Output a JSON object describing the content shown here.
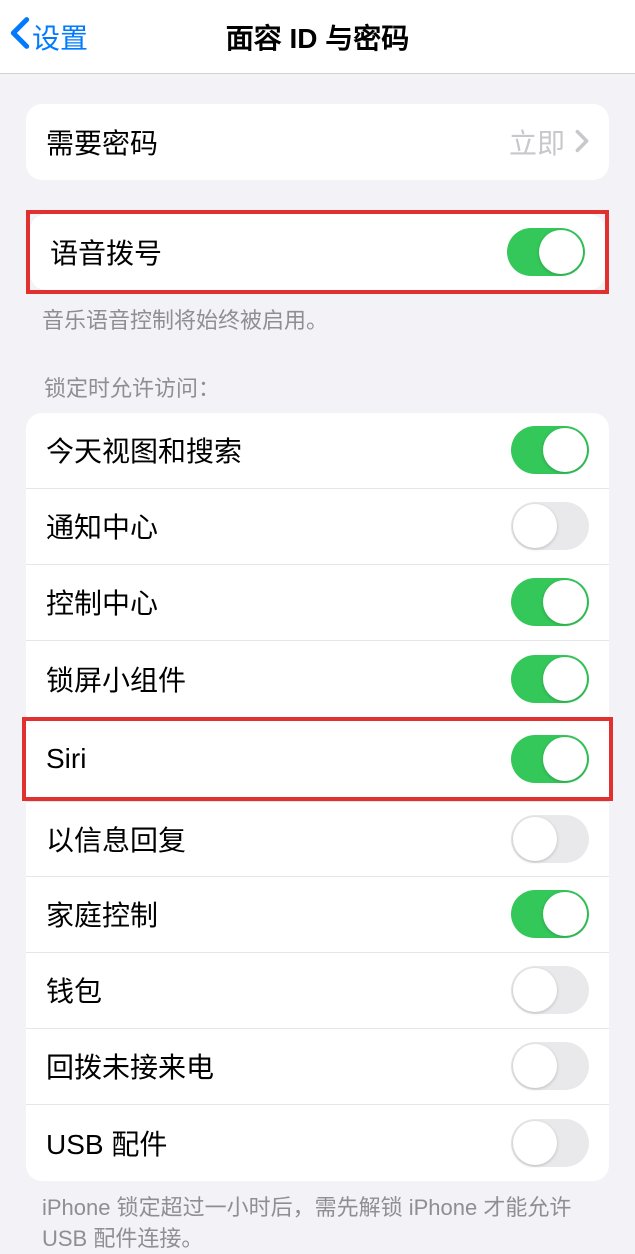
{
  "header": {
    "back_label": "设置",
    "title": "面容 ID 与密码"
  },
  "passcode_row": {
    "label": "需要密码",
    "value": "立即"
  },
  "voice_dial": {
    "label": "语音拨号",
    "on": true,
    "footer": "音乐语音控制将始终被启用。"
  },
  "lock_section": {
    "header": "锁定时允许访问：",
    "items": [
      {
        "label": "今天视图和搜索",
        "on": true
      },
      {
        "label": "通知中心",
        "on": false
      },
      {
        "label": "控制中心",
        "on": true
      },
      {
        "label": "锁屏小组件",
        "on": true
      },
      {
        "label": "Siri",
        "on": true,
        "highlight": true
      },
      {
        "label": "以信息回复",
        "on": false
      },
      {
        "label": "家庭控制",
        "on": true
      },
      {
        "label": "钱包",
        "on": false
      },
      {
        "label": "回拨未接来电",
        "on": false
      },
      {
        "label": "USB 配件",
        "on": false
      }
    ],
    "footer": "iPhone 锁定超过一小时后，需先解锁 iPhone 才能允许 USB 配件连接。"
  }
}
